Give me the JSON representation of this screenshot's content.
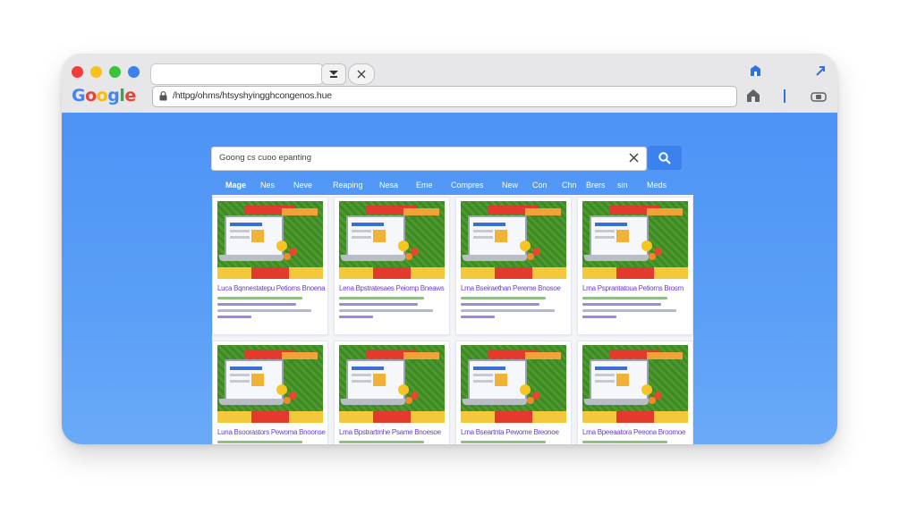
{
  "browser": {
    "logo": "Google",
    "url": "/httpg/ohms/htsyshyingghcongenos.hue",
    "window_colors": {
      "red": "#ef3d3a",
      "yellow": "#f7c21e",
      "green": "#3ec23d",
      "blue": "#3a82f0"
    },
    "icons": [
      "lock-icon",
      "download-icon",
      "close-icon",
      "home-icon",
      "extension-icon",
      "share-icon",
      "camera-icon"
    ]
  },
  "search": {
    "query": "Goong cs cuoo epanting"
  },
  "tabs": [
    "Mage",
    "Nes",
    "Neve",
    "Reaping",
    "Nesa",
    "Eme",
    "Compres",
    "New",
    "Con",
    "Chn",
    "Brers",
    "sin",
    "Meds"
  ],
  "results": [
    {
      "title": "Luca  Bqnnestatepu Petioms Bnoena"
    },
    {
      "title": "Lena  Bpstratesaes Peiomp Bneaws"
    },
    {
      "title": "Lrna  Bseiraethan Pereme Bnosoe"
    },
    {
      "title": "Lrna  Psprantatoua Petioms Brosm"
    },
    {
      "title": "Luna  Bsoorastors Pewoma Bnoonse"
    },
    {
      "title": "Lrna  Bpstrartmhe Psame Bnoesoe"
    },
    {
      "title": "Lrna  Bseartnta Pewome Breonoe"
    },
    {
      "title": "Lrna  Bpeeaatora Peeona Broomoe"
    }
  ],
  "colors": {
    "page_bg": "#5a9ff7",
    "search_button": "#3b82ee",
    "result_title": "#6a3fd0"
  }
}
